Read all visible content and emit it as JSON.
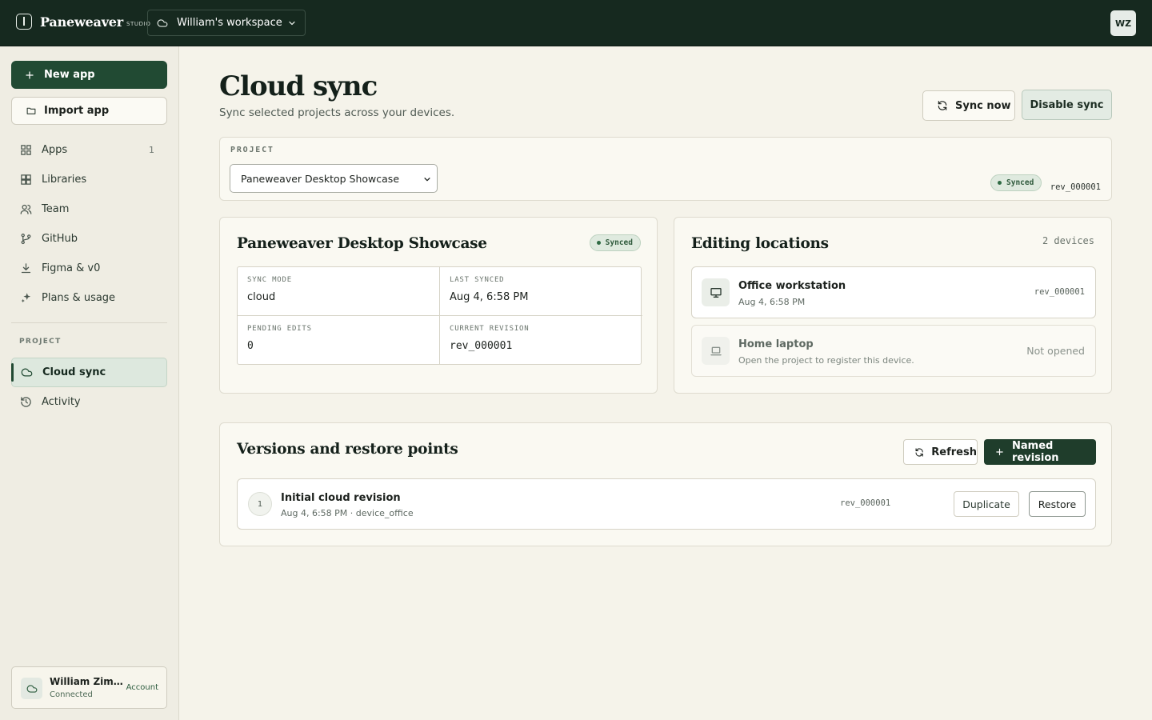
{
  "topbar": {
    "brand_name": "Paneweaver",
    "brand_sub": "STUDIO",
    "workspace": "William's workspace",
    "avatar_initials": "WZ"
  },
  "sidebar": {
    "new_app": "New app",
    "import_app": "Import app",
    "items": [
      {
        "label": "Apps",
        "count": "1",
        "icon": "apps-grid-icon"
      },
      {
        "label": "Libraries",
        "icon": "libraries-icon"
      },
      {
        "label": "Team",
        "icon": "team-icon"
      },
      {
        "label": "GitHub",
        "icon": "git-branch-icon"
      },
      {
        "label": "Figma & v0",
        "icon": "download-icon"
      },
      {
        "label": "Plans & usage",
        "icon": "sparkle-icon"
      }
    ],
    "section_label": "PROJECT",
    "project_items": [
      {
        "label": "Cloud sync",
        "active": true,
        "icon": "cloud-icon"
      },
      {
        "label": "Activity",
        "icon": "history-icon"
      }
    ],
    "account": {
      "name": "William Zimmerman",
      "status": "Connected",
      "link": "Account"
    }
  },
  "header": {
    "title": "Cloud sync",
    "subtitle": "Sync selected projects across your devices.",
    "sync_now": "Sync now",
    "disable_sync": "Disable sync"
  },
  "project": {
    "label": "PROJECT",
    "selected": "Paneweaver Desktop Showcase",
    "status": "Synced",
    "revision": "rev_000001"
  },
  "showcase": {
    "title": "Paneweaver Desktop Showcase",
    "status": "Synced",
    "fields": {
      "sync_mode_label": "SYNC MODE",
      "sync_mode": "cloud",
      "last_synced_label": "LAST SYNCED",
      "last_synced": "Aug 4, 6:58 PM",
      "pending_label": "PENDING EDITS",
      "pending": "0",
      "current_rev_label": "CURRENT REVISION",
      "current_rev": "rev_000001"
    }
  },
  "locations": {
    "title": "Editing locations",
    "count": "2 devices",
    "devices": [
      {
        "name": "Office workstation",
        "meta": "Aug 4, 6:58 PM",
        "right": "rev_000001"
      },
      {
        "name": "Home laptop",
        "meta": "Open the project to register this device.",
        "right": "Not opened"
      }
    ]
  },
  "versions": {
    "title": "Versions and restore points",
    "refresh": "Refresh",
    "named_revision": "Named revision",
    "rows": [
      {
        "num": "1",
        "name": "Initial cloud revision",
        "meta": "Aug 4, 6:58 PM · device_office",
        "rev": "rev_000001",
        "duplicate": "Duplicate",
        "restore": "Restore"
      }
    ]
  },
  "colors": {
    "topbar": "#16291f",
    "accent": "#214a33",
    "background": "#f5f3ea",
    "synced_pill": "#dfeadf"
  }
}
